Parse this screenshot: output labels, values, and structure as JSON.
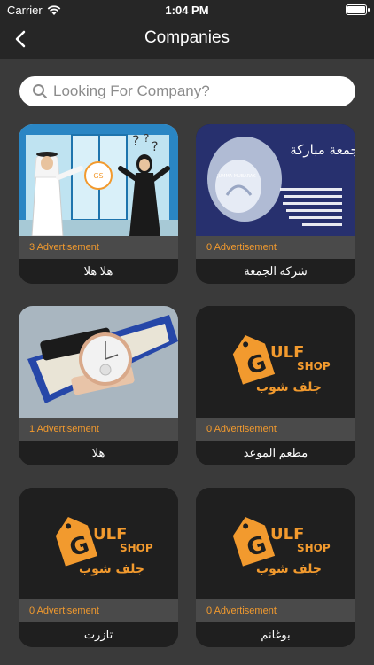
{
  "status_bar": {
    "carrier": "Carrier",
    "time": "1:04 PM"
  },
  "nav": {
    "title": "Companies"
  },
  "search": {
    "placeholder": "Looking For Company?"
  },
  "logo": {
    "gulf": "ULF",
    "shop": "SHOP",
    "arabic": "جلف شوب"
  },
  "friday_image": {
    "title": "جمعة مباركة",
    "caption": "JUMMA MUBARAK"
  },
  "companies": [
    {
      "count": "3 Advertisement",
      "name": "هلا هلا",
      "image": "office-people-illustration"
    },
    {
      "count": "0 Advertisement",
      "name": "شركه الجمعة",
      "image": "jumma-mubarak-card"
    },
    {
      "count": "1 Advertisement",
      "name": "هلا",
      "image": "watch-photo"
    },
    {
      "count": "0 Advertisement",
      "name": "مطعم الموعد",
      "image": "gulf-shop-logo"
    },
    {
      "count": "0 Advertisement",
      "name": "تازرت",
      "image": "gulf-shop-logo"
    },
    {
      "count": "0 Advertisement",
      "name": "بوغانم",
      "image": "gulf-shop-logo"
    }
  ],
  "colors": {
    "background": "#3a3a3a",
    "bar": "#262626",
    "accent": "#f29a2e"
  }
}
